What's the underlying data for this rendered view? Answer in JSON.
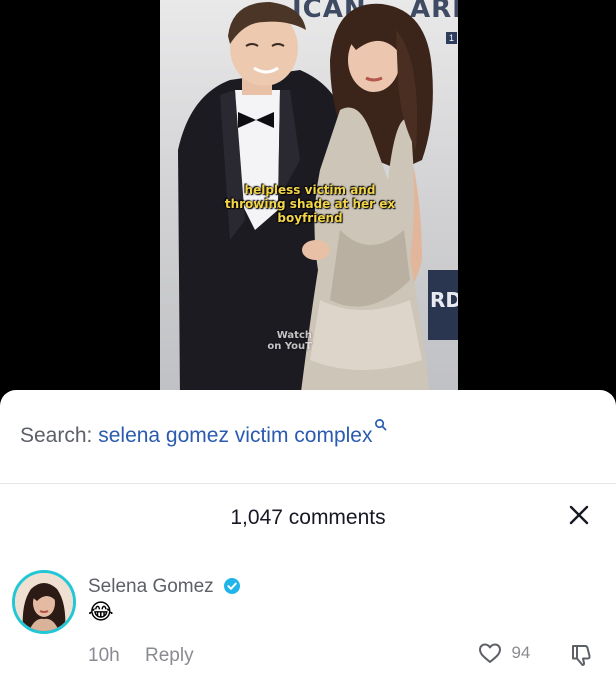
{
  "video": {
    "caption_lines": [
      "helpless victim and",
      "throwing shade at her ex",
      "boyfriend"
    ],
    "watermark_lines": [
      "Watch",
      "on YouT"
    ],
    "backdrop_text_left": "ICAN",
    "backdrop_text_right": "ARD",
    "backdrop_side_text": "RDS",
    "backdrop_number": "1"
  },
  "search": {
    "prefix": "Search:",
    "term": "selena gomez victim complex",
    "icon": "search-icon",
    "term_color": "#2b5bb0"
  },
  "comments_panel": {
    "count_label": "1,047 comments",
    "close_icon": "close-icon"
  },
  "comment": {
    "author": "Selena Gomez",
    "verified": true,
    "verified_color": "#20b4e8",
    "avatar_ring_color": "#22c7d6",
    "text": "😂",
    "time": "10h",
    "reply_label": "Reply",
    "likes": "94",
    "like_icon": "heart-icon",
    "dislike_icon": "thumbs-down-icon"
  }
}
